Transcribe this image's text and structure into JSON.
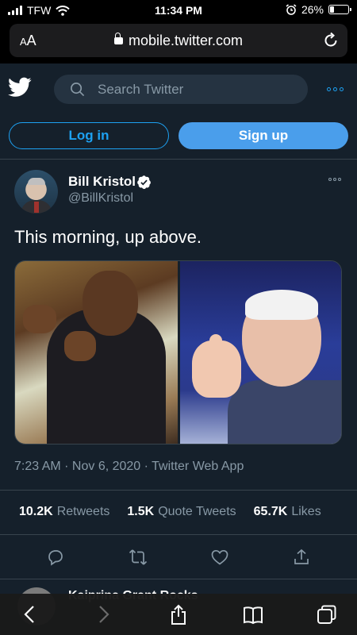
{
  "status_bar": {
    "carrier": "TFW",
    "time": "11:34 PM",
    "battery": "26%",
    "battery_level": 0.26
  },
  "browser": {
    "text_size_label_small": "A",
    "text_size_label_large": "A",
    "url": "mobile.twitter.com"
  },
  "header": {
    "search_placeholder": "Search Twitter"
  },
  "auth": {
    "login_label": "Log in",
    "signup_label": "Sign up"
  },
  "tweet": {
    "display_name": "Bill Kristol",
    "handle": "@BillKristol",
    "text": "This morning, up above.",
    "timestamp": "7:23 AM · Nov 6, 2020 · Twitter Web App",
    "stats": [
      {
        "count": "10.2K",
        "label": "Retweets"
      },
      {
        "count": "1.5K",
        "label": "Quote Tweets"
      },
      {
        "count": "65.7K",
        "label": "Likes"
      }
    ]
  },
  "next_tweet": {
    "display_name": "Kaiprina Grant Rocks"
  },
  "colors": {
    "background": "#15202b",
    "accent": "#1da1f2",
    "signup_button": "#4a9eeb",
    "secondary_text": "#8899a6",
    "divider": "#38444d"
  },
  "icons": [
    "twitter-bird-icon",
    "search-icon",
    "more-icon",
    "verified-badge-icon",
    "reply-icon",
    "retweet-icon",
    "like-icon",
    "share-icon",
    "back-icon",
    "forward-icon",
    "share-sheet-icon",
    "bookmarks-icon",
    "tabs-icon",
    "reload-icon",
    "lock-icon",
    "wifi-icon",
    "alarm-icon"
  ]
}
